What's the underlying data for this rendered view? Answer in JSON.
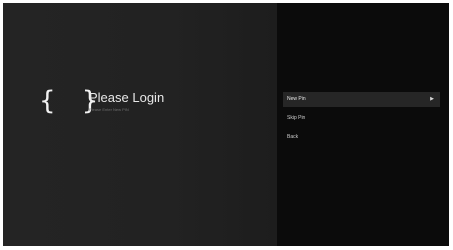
{
  "login": {
    "brace_icon": "{ }",
    "title": "Please Login",
    "subtitle": "Please Enter New PIN"
  },
  "menu": {
    "items": [
      {
        "label": "New Pin",
        "icon": "chevron-right-icon",
        "selected": true
      },
      {
        "label": "Skip Pin",
        "selected": false
      },
      {
        "label": "Back",
        "selected": false
      }
    ]
  },
  "colors": {
    "background": "#1c1c1c",
    "menu_panel": "#0b0b0b",
    "selected_item": "#262626",
    "text": "#e8e8e8",
    "subtext": "#6d6d6d"
  }
}
